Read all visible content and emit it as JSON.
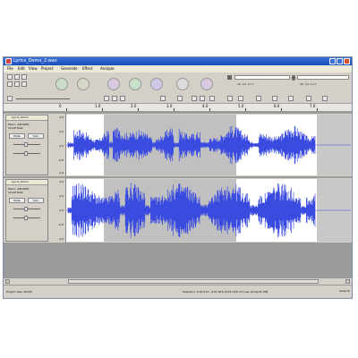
{
  "window": {
    "title": "Lyrics_Demo_2.wav",
    "controls": {
      "minimize": "minimize-icon",
      "maximize": "maximize-icon",
      "close": "close-icon"
    }
  },
  "menu": [
    "File",
    "Edit",
    "View",
    "Project",
    "Generate",
    "Effect",
    "Analyze"
  ],
  "toolbar": {
    "transport": [
      "skip-to-start",
      "skip-to-end",
      "pause",
      "play",
      "stop",
      "record",
      "loop"
    ],
    "meters": {
      "playback_scale": "-36 -24 -12 0",
      "record_scale": "-36 -24 -12 0"
    }
  },
  "ruler": {
    "labels": [
      "0",
      "1.0",
      "2.0",
      "3.0",
      "4.0",
      "5.0",
      "6.0",
      "7.0"
    ]
  },
  "tracks": [
    {
      "name": "Lyrics_Demo",
      "info": [
        "Mono, 44100Hz",
        "32-bit float"
      ],
      "buttons": {
        "mute": "Mute",
        "solo": "Solo"
      },
      "scale": [
        "1.0",
        "0.5",
        "0.0",
        "-0.5",
        "-1.0"
      ]
    },
    {
      "name": "Lyrics_Demo",
      "info": [
        "Mono, 44100Hz",
        "32-bit float"
      ],
      "buttons": {
        "mute": "Mute",
        "solo": "Solo"
      },
      "scale": [
        "1.0",
        "0.5",
        "0.0",
        "-0.5",
        "-1.0"
      ]
    }
  ],
  "status": {
    "rate": "Project rate: 44100",
    "selection": "Selection: 0:03.273 - 0:07.016 (0:03.743) min:sec  [Snap-To Off]",
    "corner": "Snap To"
  },
  "colors": {
    "waveform": "#3a4be0",
    "selection": "#c0c0c0",
    "title_bar": "#2a5fc8"
  }
}
